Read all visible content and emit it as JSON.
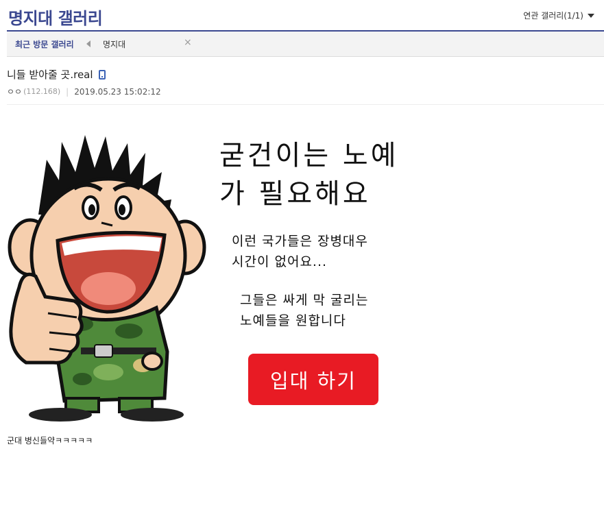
{
  "header": {
    "gallery_title": "명지대 갤러리",
    "related_label": "연관 갤러리(1/1)"
  },
  "recent": {
    "label": "최근 방문 갤러리",
    "item": "명지대",
    "close_glyph": "×"
  },
  "post": {
    "title": "니들 받아줄 곳.real",
    "author": "ㅇㅇ",
    "ip": "(112.168)",
    "datetime": "2019.05.23 15:02:12",
    "body": "군대 병신들약ㅋㅋㅋㅋㅋ"
  },
  "poster": {
    "headline_1": "굳건이는 노예",
    "headline_2": "가 필요해요",
    "para1_line1": "이런 국가들은 장병대우",
    "para1_line2": "시간이 없어요...",
    "para2_line1": "그들은 싸게 막 굴리는",
    "para2_line2": "노예들을 원합니다",
    "button": "입대 하기"
  },
  "colors": {
    "brand": "#3b4890",
    "button_red": "#e81b24",
    "camo_green": "#4f8a3a",
    "skin": "#f6cfae"
  }
}
